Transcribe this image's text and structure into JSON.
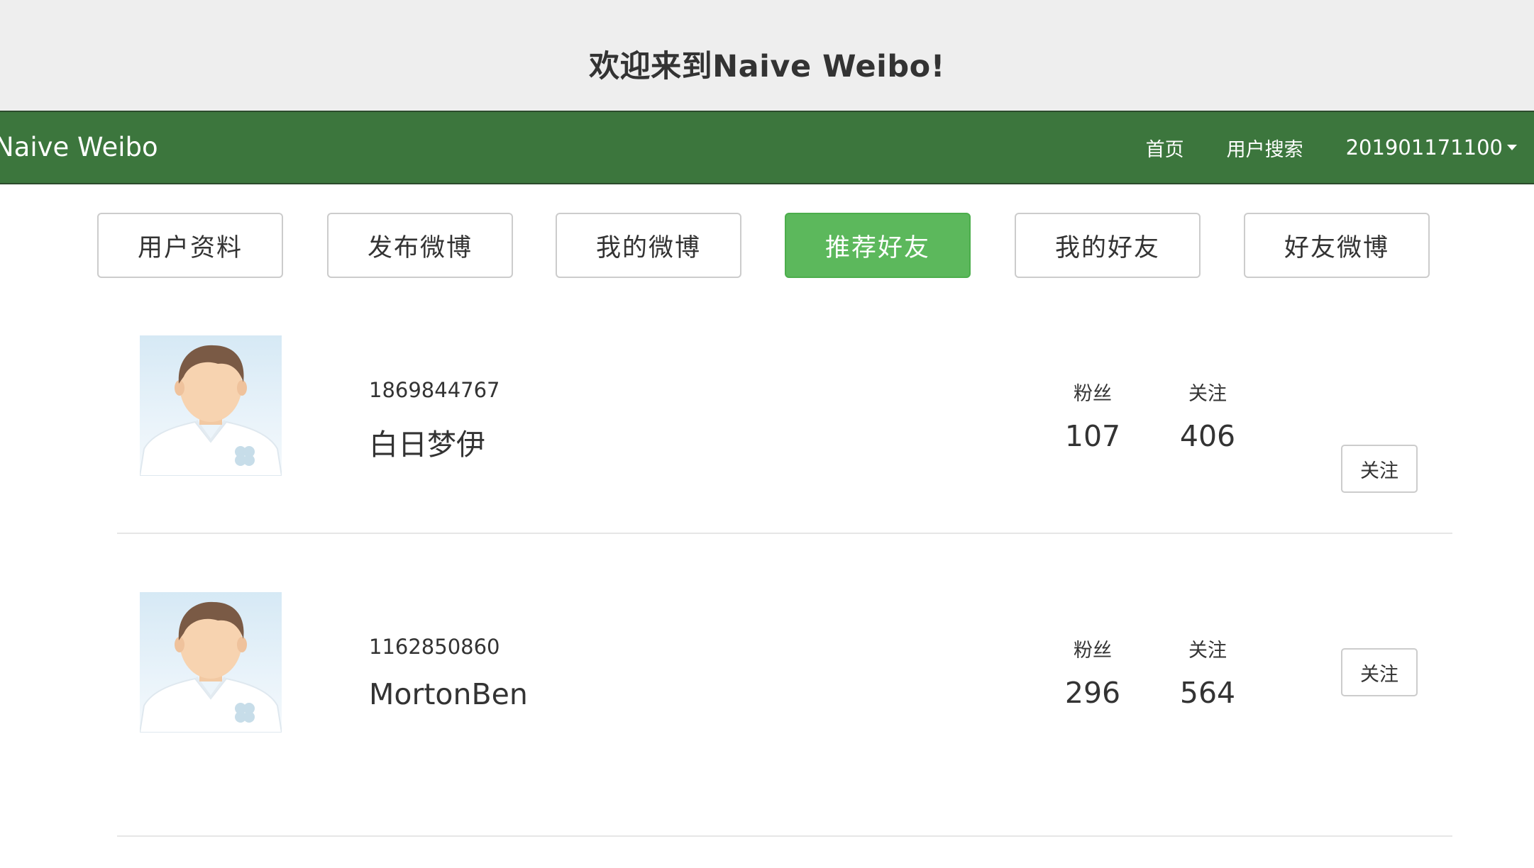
{
  "banner": {
    "title": "欢迎来到Naive Weibo!"
  },
  "navbar": {
    "brand": "Naive Weibo",
    "links": [
      {
        "label": "首页"
      },
      {
        "label": "用户搜索"
      }
    ],
    "user_menu": "201901171100",
    "bg_color": "#3c763d"
  },
  "tabs": [
    {
      "label": "用户资料",
      "active": false
    },
    {
      "label": "发布微博",
      "active": false
    },
    {
      "label": "我的微博",
      "active": false
    },
    {
      "label": "推荐好友",
      "active": true
    },
    {
      "label": "我的好友",
      "active": false
    },
    {
      "label": "好友微博",
      "active": false
    }
  ],
  "accent_color": "#5cb85c",
  "users": [
    {
      "id": "1869844767",
      "name": "白日梦伊",
      "fans_label": "粉丝",
      "fans": "107",
      "following_label": "关注",
      "following": "406",
      "follow_button": "关注",
      "avatar_icon": "default-male-avatar-icon"
    },
    {
      "id": "1162850860",
      "name": "MortonBen",
      "fans_label": "粉丝",
      "fans": "296",
      "following_label": "关注",
      "following": "564",
      "follow_button": "关注",
      "avatar_icon": "default-male-avatar-icon"
    }
  ]
}
